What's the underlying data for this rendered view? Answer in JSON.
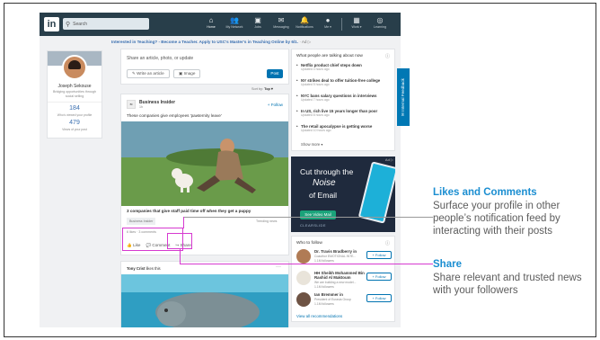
{
  "nav": {
    "logo": "in",
    "search_placeholder": "Search",
    "items": [
      {
        "label": "Home",
        "icon": "home-icon",
        "glyph": "⌂"
      },
      {
        "label": "My Network",
        "icon": "people-icon",
        "glyph": "👥"
      },
      {
        "label": "Jobs",
        "icon": "briefcase-icon",
        "glyph": "▣"
      },
      {
        "label": "Messaging",
        "icon": "message-icon",
        "glyph": "✉"
      },
      {
        "label": "Notifications",
        "icon": "bell-icon",
        "glyph": "🔔"
      },
      {
        "label": "Me ▾",
        "icon": "me-avatar-icon",
        "glyph": "●"
      },
      {
        "label": "Work ▾",
        "icon": "grid-icon",
        "glyph": "▦"
      },
      {
        "label": "Learning",
        "icon": "compass-icon",
        "glyph": "◎"
      }
    ]
  },
  "promo": {
    "text": "Interested in Teaching? - Become a Teacher. Apply to USC's Master's in Teaching Online by 6/1.",
    "ad": "· Ad ▷"
  },
  "profile": {
    "name": "Joseph Sekouse",
    "headline": "Bridging opportunities through social selling",
    "stat1_value": "184",
    "stat1_label": "Who's viewed your profile",
    "stat2_value": "479",
    "stat2_label": "Views of your post"
  },
  "share_box": {
    "placeholder": "Share an article, photo, or update",
    "write_article": "✎ Write an article",
    "image": "▣ Image",
    "post": "Post"
  },
  "sort": {
    "label": "Sort by:",
    "value": "Top ▾"
  },
  "post1": {
    "logo": "BI",
    "publisher": "Business Insider",
    "publisher_sub": "1h",
    "follow": "+ Follow",
    "text": "These companies give employees 'pawternity leave'",
    "article_title": "3 companies that give staff paid time off when they get a puppy",
    "tag": "Business Insider",
    "tag2": "Trending news",
    "counts": "6 likes · 3 comments",
    "like": "👍 Like",
    "comment": "💬 Comment",
    "share": "↪ Share"
  },
  "post2": {
    "author": "Tony Crist",
    "action": " likes this",
    "more": "···"
  },
  "news": {
    "heading": "What people are talking about now",
    "info": "ⓘ",
    "items": [
      {
        "title": "Netflix product chief steps down",
        "updated": "Updated 4 hours ago"
      },
      {
        "title": "NY strikes deal to offer tuition-free college",
        "updated": "Updated 5 hours ago"
      },
      {
        "title": "NYC bans salary questions in interviews",
        "updated": "Updated 7 hours ago"
      },
      {
        "title": "In US, rich live 15 years longer than poor",
        "updated": "Updated 8 hours ago"
      },
      {
        "title": "The retail apocalypse is getting worse",
        "updated": "Updated 10 hours ago"
      }
    ],
    "show_more": "Show more ▾"
  },
  "ad": {
    "line1": "Cut through the",
    "line2": "Noise",
    "line3": "of Email",
    "cta": "See Video Mail",
    "brand": "CLEARSLIDE",
    "ad_mark": "Ad ▷"
  },
  "wtf": {
    "heading": "Who to follow",
    "info": "ⓘ",
    "people": [
      {
        "name": "Dr. Travis Bradberry in",
        "title": "Coauthor EMOTIONAL INTE...",
        "followers": "1.1M followers",
        "follow": "+ Follow"
      },
      {
        "name": "HH Sheikh Mohammed Bin Rashid Al Maktoum",
        "title": "We are building a new model...",
        "followers": "1.1M followers",
        "follow": "+ Follow"
      },
      {
        "name": "Ian Bremmer in",
        "title": "President of Eurasia Group",
        "followers": "1.1M followers",
        "follow": "+ Follow"
      }
    ],
    "view_all": "View all recommendations"
  },
  "feedback": "✉ Internal Feedback",
  "callouts": {
    "likes_title": "Likes and Comments",
    "likes_body": "Surface your profile in other people’s notification feed by interacting with their posts",
    "share_title": "Share",
    "share_body": "Share relevant and trusted news with your followers"
  },
  "colors": {
    "accent": "#1b8ed1",
    "highlight": "#d63ad0",
    "nav": "#283e4a",
    "linkedin_blue": "#0073b1"
  }
}
